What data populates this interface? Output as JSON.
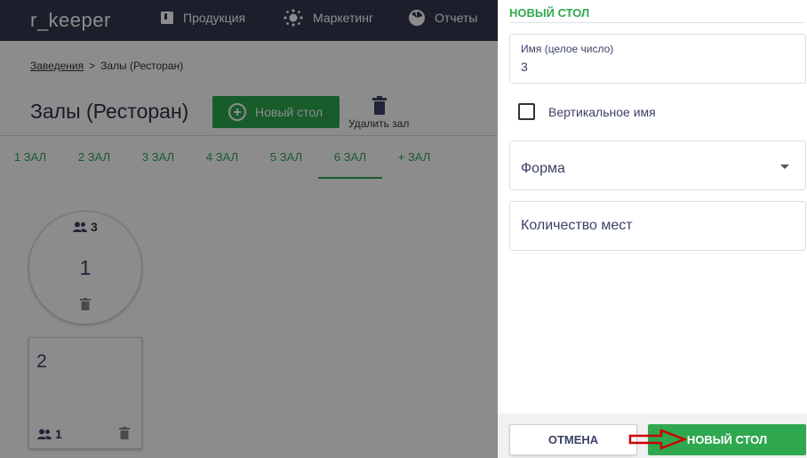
{
  "app": {
    "logo": "r_keeper",
    "nav": [
      {
        "label": "Продукция",
        "icon": "book-icon"
      },
      {
        "label": "Маркетинг",
        "icon": "marketing-icon"
      },
      {
        "label": "Отчеты",
        "icon": "chart-pie-icon"
      }
    ]
  },
  "breadcrumb": {
    "link": "Заведения",
    "separator": ">",
    "current": "Залы (Ресторан)"
  },
  "page": {
    "title": "Залы (Ресторан)",
    "new_table_button": "Новый стол",
    "delete_hall_label": "Удалить зал"
  },
  "tabs": [
    {
      "label": "1 ЗАЛ",
      "active": false
    },
    {
      "label": "2 ЗАЛ",
      "active": false
    },
    {
      "label": "3 ЗАЛ",
      "active": false
    },
    {
      "label": "4 ЗАЛ",
      "active": false
    },
    {
      "label": "5 ЗАЛ",
      "active": false
    },
    {
      "label": "6 ЗАЛ",
      "active": true
    },
    {
      "label": "+ ЗАЛ",
      "active": false
    }
  ],
  "tables": [
    {
      "name": "1",
      "seats": "3",
      "shape": "round"
    },
    {
      "name": "2",
      "seats": "1",
      "shape": "square"
    }
  ],
  "panel": {
    "title": "НОВЫЙ СТОЛ",
    "name_field": {
      "label": "Имя (целое число)",
      "value": "3"
    },
    "vertical_name": {
      "label": "Вертикальное имя",
      "checked": false
    },
    "shape_field": {
      "placeholder": "Форма"
    },
    "seats_field": {
      "placeholder": "Количество мест"
    },
    "cancel_button": "ОТМЕНА",
    "submit_button": "НОВЫЙ СТОЛ"
  },
  "colors": {
    "accent": "#2fa84f",
    "topbar": "#343a4f",
    "text": "#3c4266",
    "arrow": "#cc0000"
  }
}
